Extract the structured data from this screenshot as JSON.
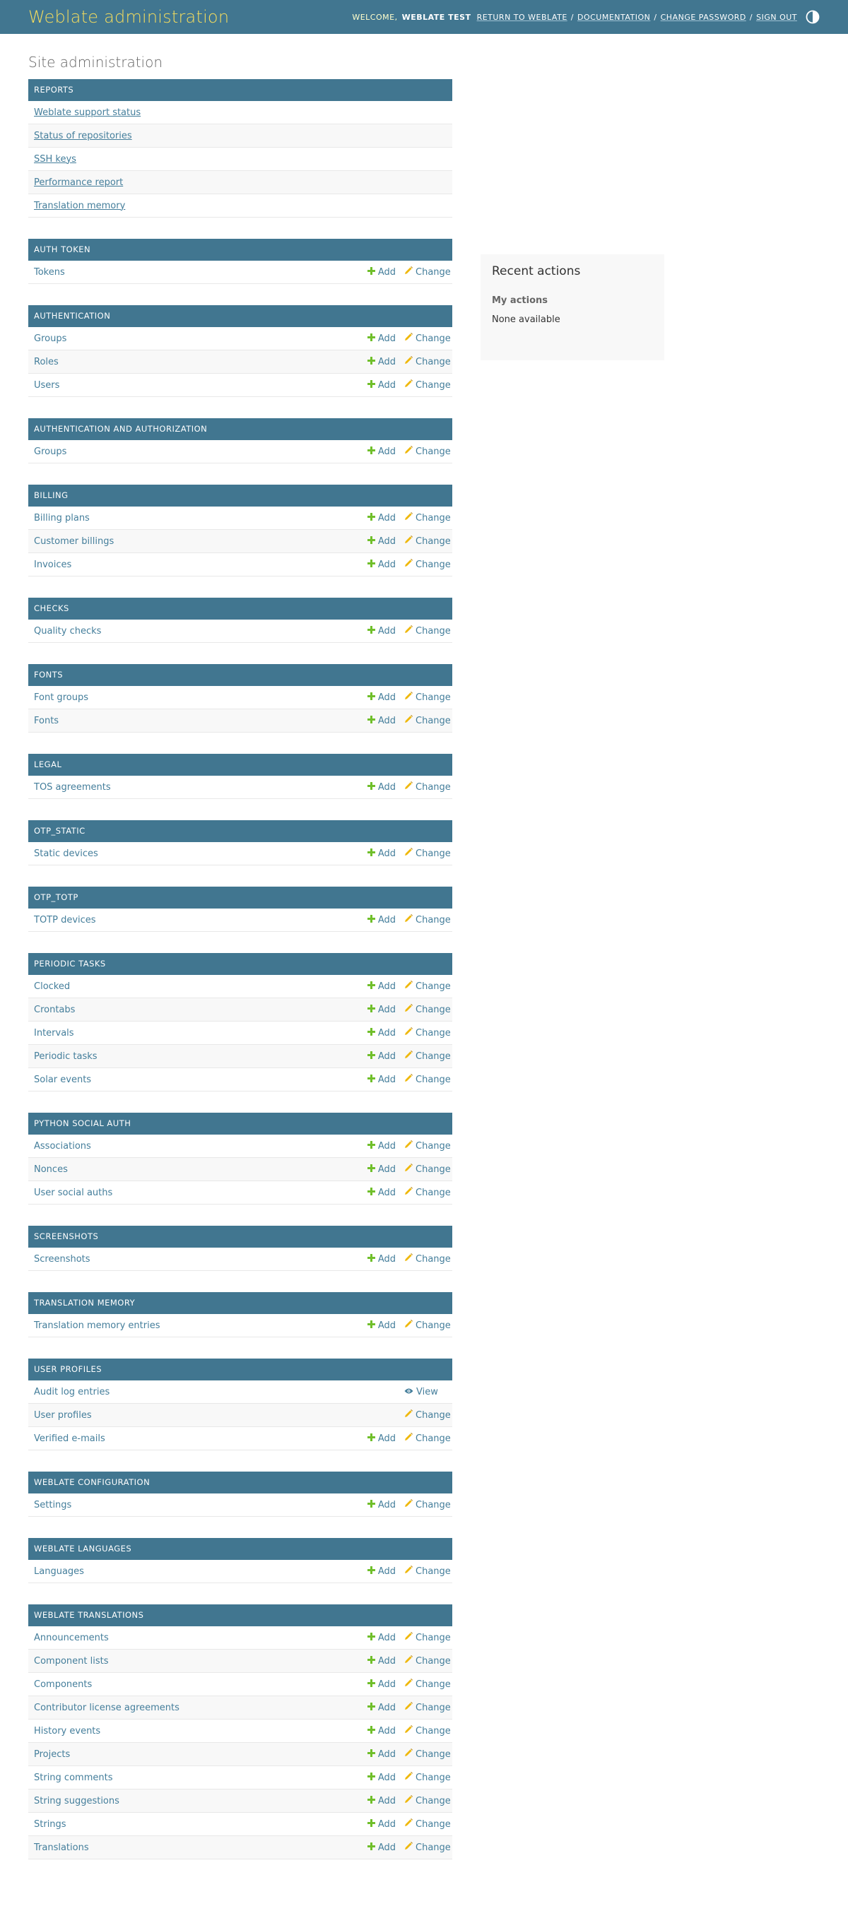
{
  "header": {
    "branding": "Weblate administration",
    "welcome": "Welcome,",
    "username": "Weblate Test",
    "links": [
      "Return to Weblate",
      "Documentation",
      "Change password",
      "Sign out"
    ],
    "theme_toggle_icon": "contrast-icon"
  },
  "page_title": "Site administration",
  "labels": {
    "add": "Add",
    "change": "Change",
    "view": "View"
  },
  "colors": {
    "header_bg": "#417690",
    "branding": "#f5dd5d",
    "add_icon": "#70bf2b",
    "change_icon": "#efb80b",
    "view_icon": "#447e9b"
  },
  "reports": {
    "caption": "Reports",
    "items": [
      "Weblate support status",
      "Status of repositories",
      "SSH keys",
      "Performance report",
      "Translation memory"
    ]
  },
  "modules": [
    {
      "caption": "Auth Token",
      "rows": [
        {
          "name": "Tokens",
          "add": true,
          "change": true
        }
      ]
    },
    {
      "caption": "Authentication",
      "rows": [
        {
          "name": "Groups",
          "add": true,
          "change": true
        },
        {
          "name": "Roles",
          "add": true,
          "change": true
        },
        {
          "name": "Users",
          "add": true,
          "change": true
        }
      ]
    },
    {
      "caption": "Authentication and Authorization",
      "rows": [
        {
          "name": "Groups",
          "add": true,
          "change": true
        }
      ]
    },
    {
      "caption": "Billing",
      "rows": [
        {
          "name": "Billing plans",
          "add": true,
          "change": true
        },
        {
          "name": "Customer billings",
          "add": true,
          "change": true
        },
        {
          "name": "Invoices",
          "add": true,
          "change": true
        }
      ]
    },
    {
      "caption": "Checks",
      "rows": [
        {
          "name": "Quality checks",
          "add": true,
          "change": true
        }
      ]
    },
    {
      "caption": "Fonts",
      "rows": [
        {
          "name": "Font groups",
          "add": true,
          "change": true
        },
        {
          "name": "Fonts",
          "add": true,
          "change": true
        }
      ]
    },
    {
      "caption": "Legal",
      "rows": [
        {
          "name": "TOS agreements",
          "add": true,
          "change": true
        }
      ]
    },
    {
      "caption": "OTP_STATIC",
      "rows": [
        {
          "name": "Static devices",
          "add": true,
          "change": true
        }
      ]
    },
    {
      "caption": "OTP_TOTP",
      "rows": [
        {
          "name": "TOTP devices",
          "add": true,
          "change": true
        }
      ]
    },
    {
      "caption": "Periodic Tasks",
      "rows": [
        {
          "name": "Clocked",
          "add": true,
          "change": true
        },
        {
          "name": "Crontabs",
          "add": true,
          "change": true
        },
        {
          "name": "Intervals",
          "add": true,
          "change": true
        },
        {
          "name": "Periodic tasks",
          "add": true,
          "change": true
        },
        {
          "name": "Solar events",
          "add": true,
          "change": true
        }
      ]
    },
    {
      "caption": "Python Social Auth",
      "rows": [
        {
          "name": "Associations",
          "add": true,
          "change": true
        },
        {
          "name": "Nonces",
          "add": true,
          "change": true
        },
        {
          "name": "User social auths",
          "add": true,
          "change": true
        }
      ]
    },
    {
      "caption": "Screenshots",
      "rows": [
        {
          "name": "Screenshots",
          "add": true,
          "change": true
        }
      ]
    },
    {
      "caption": "Translation Memory",
      "rows": [
        {
          "name": "Translation memory entries",
          "add": true,
          "change": true
        }
      ]
    },
    {
      "caption": "User Profiles",
      "rows": [
        {
          "name": "Audit log entries",
          "add": false,
          "change": false,
          "view": true
        },
        {
          "name": "User profiles",
          "add": false,
          "change": true
        },
        {
          "name": "Verified e-mails",
          "add": true,
          "change": true
        }
      ]
    },
    {
      "caption": "Weblate Configuration",
      "rows": [
        {
          "name": "Settings",
          "add": true,
          "change": true
        }
      ]
    },
    {
      "caption": "Weblate Languages",
      "rows": [
        {
          "name": "Languages",
          "add": true,
          "change": true
        }
      ]
    },
    {
      "caption": "Weblate Translations",
      "rows": [
        {
          "name": "Announcements",
          "add": true,
          "change": true
        },
        {
          "name": "Component lists",
          "add": true,
          "change": true
        },
        {
          "name": "Components",
          "add": true,
          "change": true
        },
        {
          "name": "Contributor license agreements",
          "add": true,
          "change": true
        },
        {
          "name": "History events",
          "add": true,
          "change": true
        },
        {
          "name": "Projects",
          "add": true,
          "change": true
        },
        {
          "name": "String comments",
          "add": true,
          "change": true
        },
        {
          "name": "String suggestions",
          "add": true,
          "change": true
        },
        {
          "name": "Strings",
          "add": true,
          "change": true
        },
        {
          "name": "Translations",
          "add": true,
          "change": true
        }
      ]
    }
  ],
  "recent_actions": {
    "title": "Recent actions",
    "subtitle": "My actions",
    "empty_text": "None available"
  }
}
